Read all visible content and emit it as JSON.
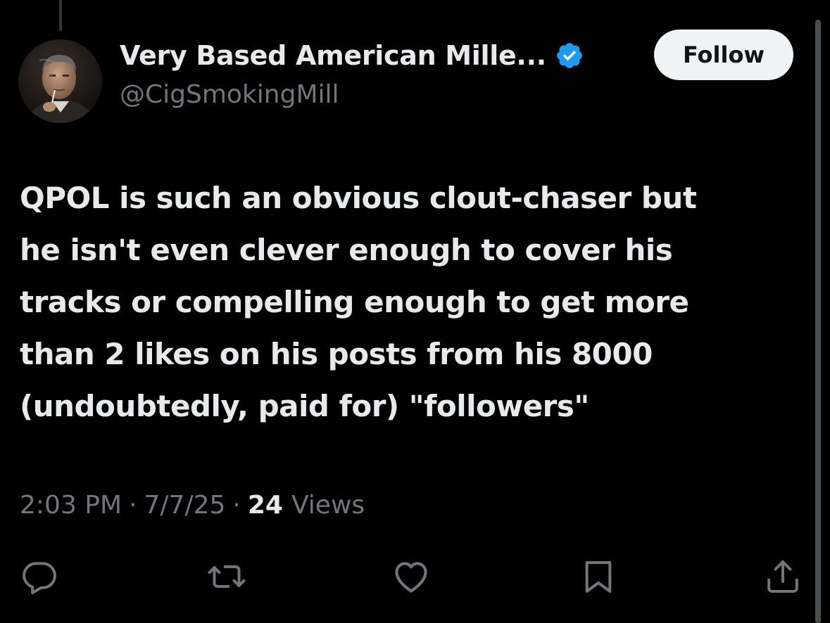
{
  "author": {
    "display_name": "Very Based American Mille...",
    "handle": "@CigSmokingMill",
    "verified": true,
    "avatar_icon": "profile-photo-man-smoking"
  },
  "follow_label": "Follow",
  "tweet": {
    "lines": [
      "QPOL is such an obvious clout-chaser but",
      "he isn't even clever enough to cover his",
      "tracks or compelling enough to get more",
      "than 2 likes on his posts from his 8000",
      "(undoubtedly, paid for) \"followers\""
    ]
  },
  "meta": {
    "time": "2:03 PM",
    "separator": "·",
    "date": "7/7/25",
    "views_count": "24",
    "views_label": "Views"
  },
  "actions": [
    {
      "name": "reply",
      "icon": "reply-icon"
    },
    {
      "name": "repost",
      "icon": "repost-icon"
    },
    {
      "name": "like",
      "icon": "heart-icon"
    },
    {
      "name": "bookmark",
      "icon": "bookmark-icon"
    },
    {
      "name": "share",
      "icon": "share-icon"
    }
  ],
  "colors": {
    "background": "#000000",
    "text_primary": "#e7e9ea",
    "text_secondary": "#71767b",
    "verified_blue": "#1d9bf0",
    "follow_bg": "#eff3f4"
  }
}
